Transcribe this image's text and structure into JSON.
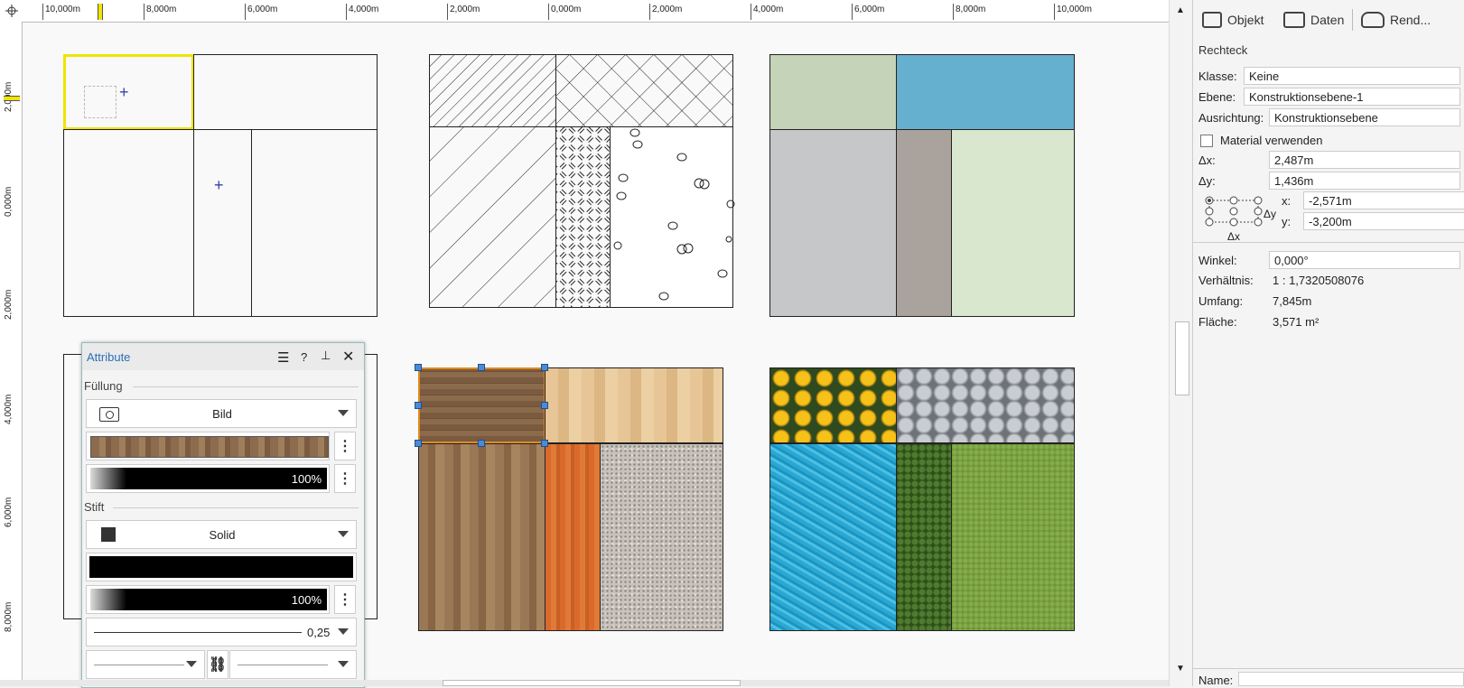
{
  "ruler": {
    "top_labels": [
      "10,000m",
      "8,000m",
      "6,000m",
      "4,000m",
      "2,000m",
      "0,000m",
      "2,000m",
      "4,000m",
      "6,000m",
      "8,000m",
      "10,000m"
    ],
    "left_labels": [
      "2,000m",
      "0,000m",
      "2,000m",
      "4,000m",
      "6,000m",
      "8,000m"
    ]
  },
  "panel": {
    "tabs": [
      {
        "label": "Objekt",
        "icon": "object-icon"
      },
      {
        "label": "Daten",
        "icon": "data-icon"
      },
      {
        "label": "Rend...",
        "icon": "render-icon"
      }
    ],
    "object_type": "Rechteck",
    "klasse_label": "Klasse:",
    "klasse_value": "Keine",
    "ebene_label": "Ebene:",
    "ebene_value": "Konstruktionsebene-1",
    "ausrichtung_label": "Ausrichtung:",
    "ausrichtung_value": "Konstruktionsebene",
    "material_label": "Material verwenden",
    "dx_label": "Δx:",
    "dx_value": "2,487m",
    "dy_label": "Δy:",
    "dy_value": "1,436m",
    "x_label": "x:",
    "x_value": "-2,571m",
    "y_label": "y:",
    "y_value": "-3,200m",
    "anchor_dx": "Δx",
    "anchor_dy": "Δy",
    "winkel_label": "Winkel:",
    "winkel_value": "0,000°",
    "verhaeltnis_label": "Verhältnis:",
    "verhaeltnis_value": "1 : 1,7320508076",
    "umfang_label": "Umfang:",
    "umfang_value": "7,845m",
    "flaeche_label": "Fläche:",
    "flaeche_value": "3,571 m²",
    "name_label": "Name:"
  },
  "attribute_dialog": {
    "title": "Attribute",
    "help": "?",
    "fuellung_label": "Füllung",
    "fill_type": "Bild",
    "fill_opacity": "100%",
    "stift_label": "Stift",
    "pen_type": "Solid",
    "pen_opacity": "100%",
    "line_weight": "0,25"
  },
  "colors": {
    "selection": "#f0e400",
    "accent": "#2a6fb8",
    "handle": "#4b8ad6",
    "sage": "#c5d3b8",
    "sky": "#66b0cf",
    "grey": "#c6c7c9",
    "taupe": "#aaa39d",
    "mint": "#d8e7cd"
  }
}
